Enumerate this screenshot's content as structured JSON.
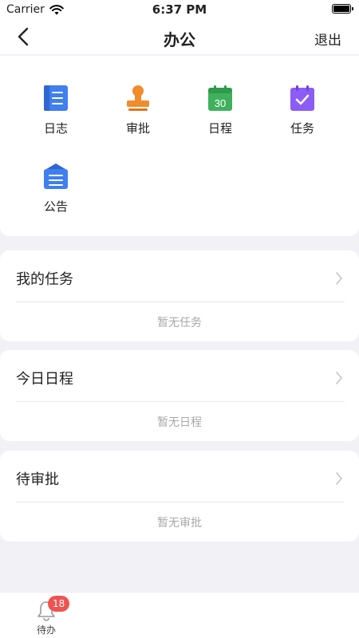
{
  "status_bar": {
    "carrier": "Carrier",
    "time": "6:37 PM"
  },
  "nav": {
    "title": "办公",
    "right_label": "退出"
  },
  "apps": [
    {
      "label": "日志",
      "icon": "log-icon",
      "color": "#3f7ff0"
    },
    {
      "label": "审批",
      "icon": "stamp-icon",
      "color": "#f08c2a"
    },
    {
      "label": "日程",
      "icon": "calendar-icon",
      "color": "#3fb15d",
      "icon_text": "30"
    },
    {
      "label": "任务",
      "icon": "task-icon",
      "color": "#8b5cf6"
    },
    {
      "label": "公告",
      "icon": "announcement-icon",
      "color": "#3f7ff0"
    }
  ],
  "sections": [
    {
      "title": "我的任务",
      "empty_text": "暂无任务"
    },
    {
      "title": "今日日程",
      "empty_text": "暂无日程"
    },
    {
      "title": "待审批",
      "empty_text": "暂无审批"
    }
  ],
  "tab_bar": {
    "items": [
      {
        "label": "待办",
        "badge": "18",
        "icon": "bell-icon"
      }
    ]
  }
}
